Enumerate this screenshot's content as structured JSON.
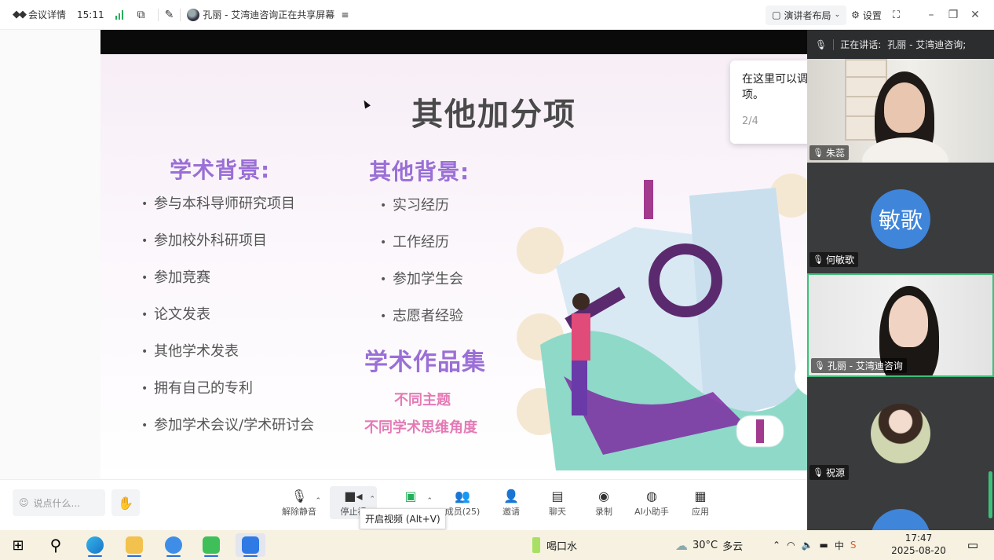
{
  "topbar": {
    "meeting_details": "会议详情",
    "time": "15:11",
    "sharing_status": "孔丽 - 艾湾迪咨询正在共享屏幕",
    "layout_label": "演讲者布局",
    "settings_label": "设置",
    "colors": {
      "signal": "#23b05b"
    }
  },
  "slide": {
    "title": "其他加分项",
    "academic_heading": "学术背景:",
    "academic_items": [
      "参与本科导师研究项目",
      "参加校外科研项目",
      "参加竞赛",
      "论文发表",
      "其他学术发表",
      "拥有自己的专利",
      "参加学术会议/学术研讨会"
    ],
    "other_heading": "其他背景:",
    "other_items": [
      "实习经历",
      "工作经历",
      "参加学生会",
      "志愿者经验"
    ],
    "portfolio_heading": "学术作品集",
    "portfolio_line1": "不同主题",
    "portfolio_line2": "不同学术思维角度",
    "colors": {
      "heading": "#9a6fd6",
      "pink": "#e57ab5"
    }
  },
  "popup": {
    "text": "在这里可以调项。",
    "step": "2/4"
  },
  "panel": {
    "speaking_label": "正在讲话:",
    "speaking_name": "孔丽 - 艾湾迪咨询;",
    "participants": [
      {
        "name": "朱蕊"
      },
      {
        "name": "何敏歌",
        "avatar_text": "敏歌"
      },
      {
        "name": "孔丽 - 艾湾迪咨询"
      },
      {
        "name": "祝源"
      }
    ],
    "colors": {
      "active_border": "#3ec07a",
      "avatar_bg": "#3f85da"
    }
  },
  "toolbar": {
    "chat_placeholder": "说点什么...",
    "unmute": "解除静音",
    "stop_video": "停止视",
    "video_tooltip": "开启视频 (Alt+V)",
    "members": "成员(25)",
    "invite": "邀请",
    "chat": "聊天",
    "record": "录制",
    "ai_assistant": "AI小助手",
    "apps": "应用"
  },
  "taskbar": {
    "drink_water": "喝口水",
    "weather_temp": "30°C",
    "weather_desc": "多云",
    "ime": "中",
    "clock_time": "17:47",
    "clock_date": "2025-08-20"
  }
}
